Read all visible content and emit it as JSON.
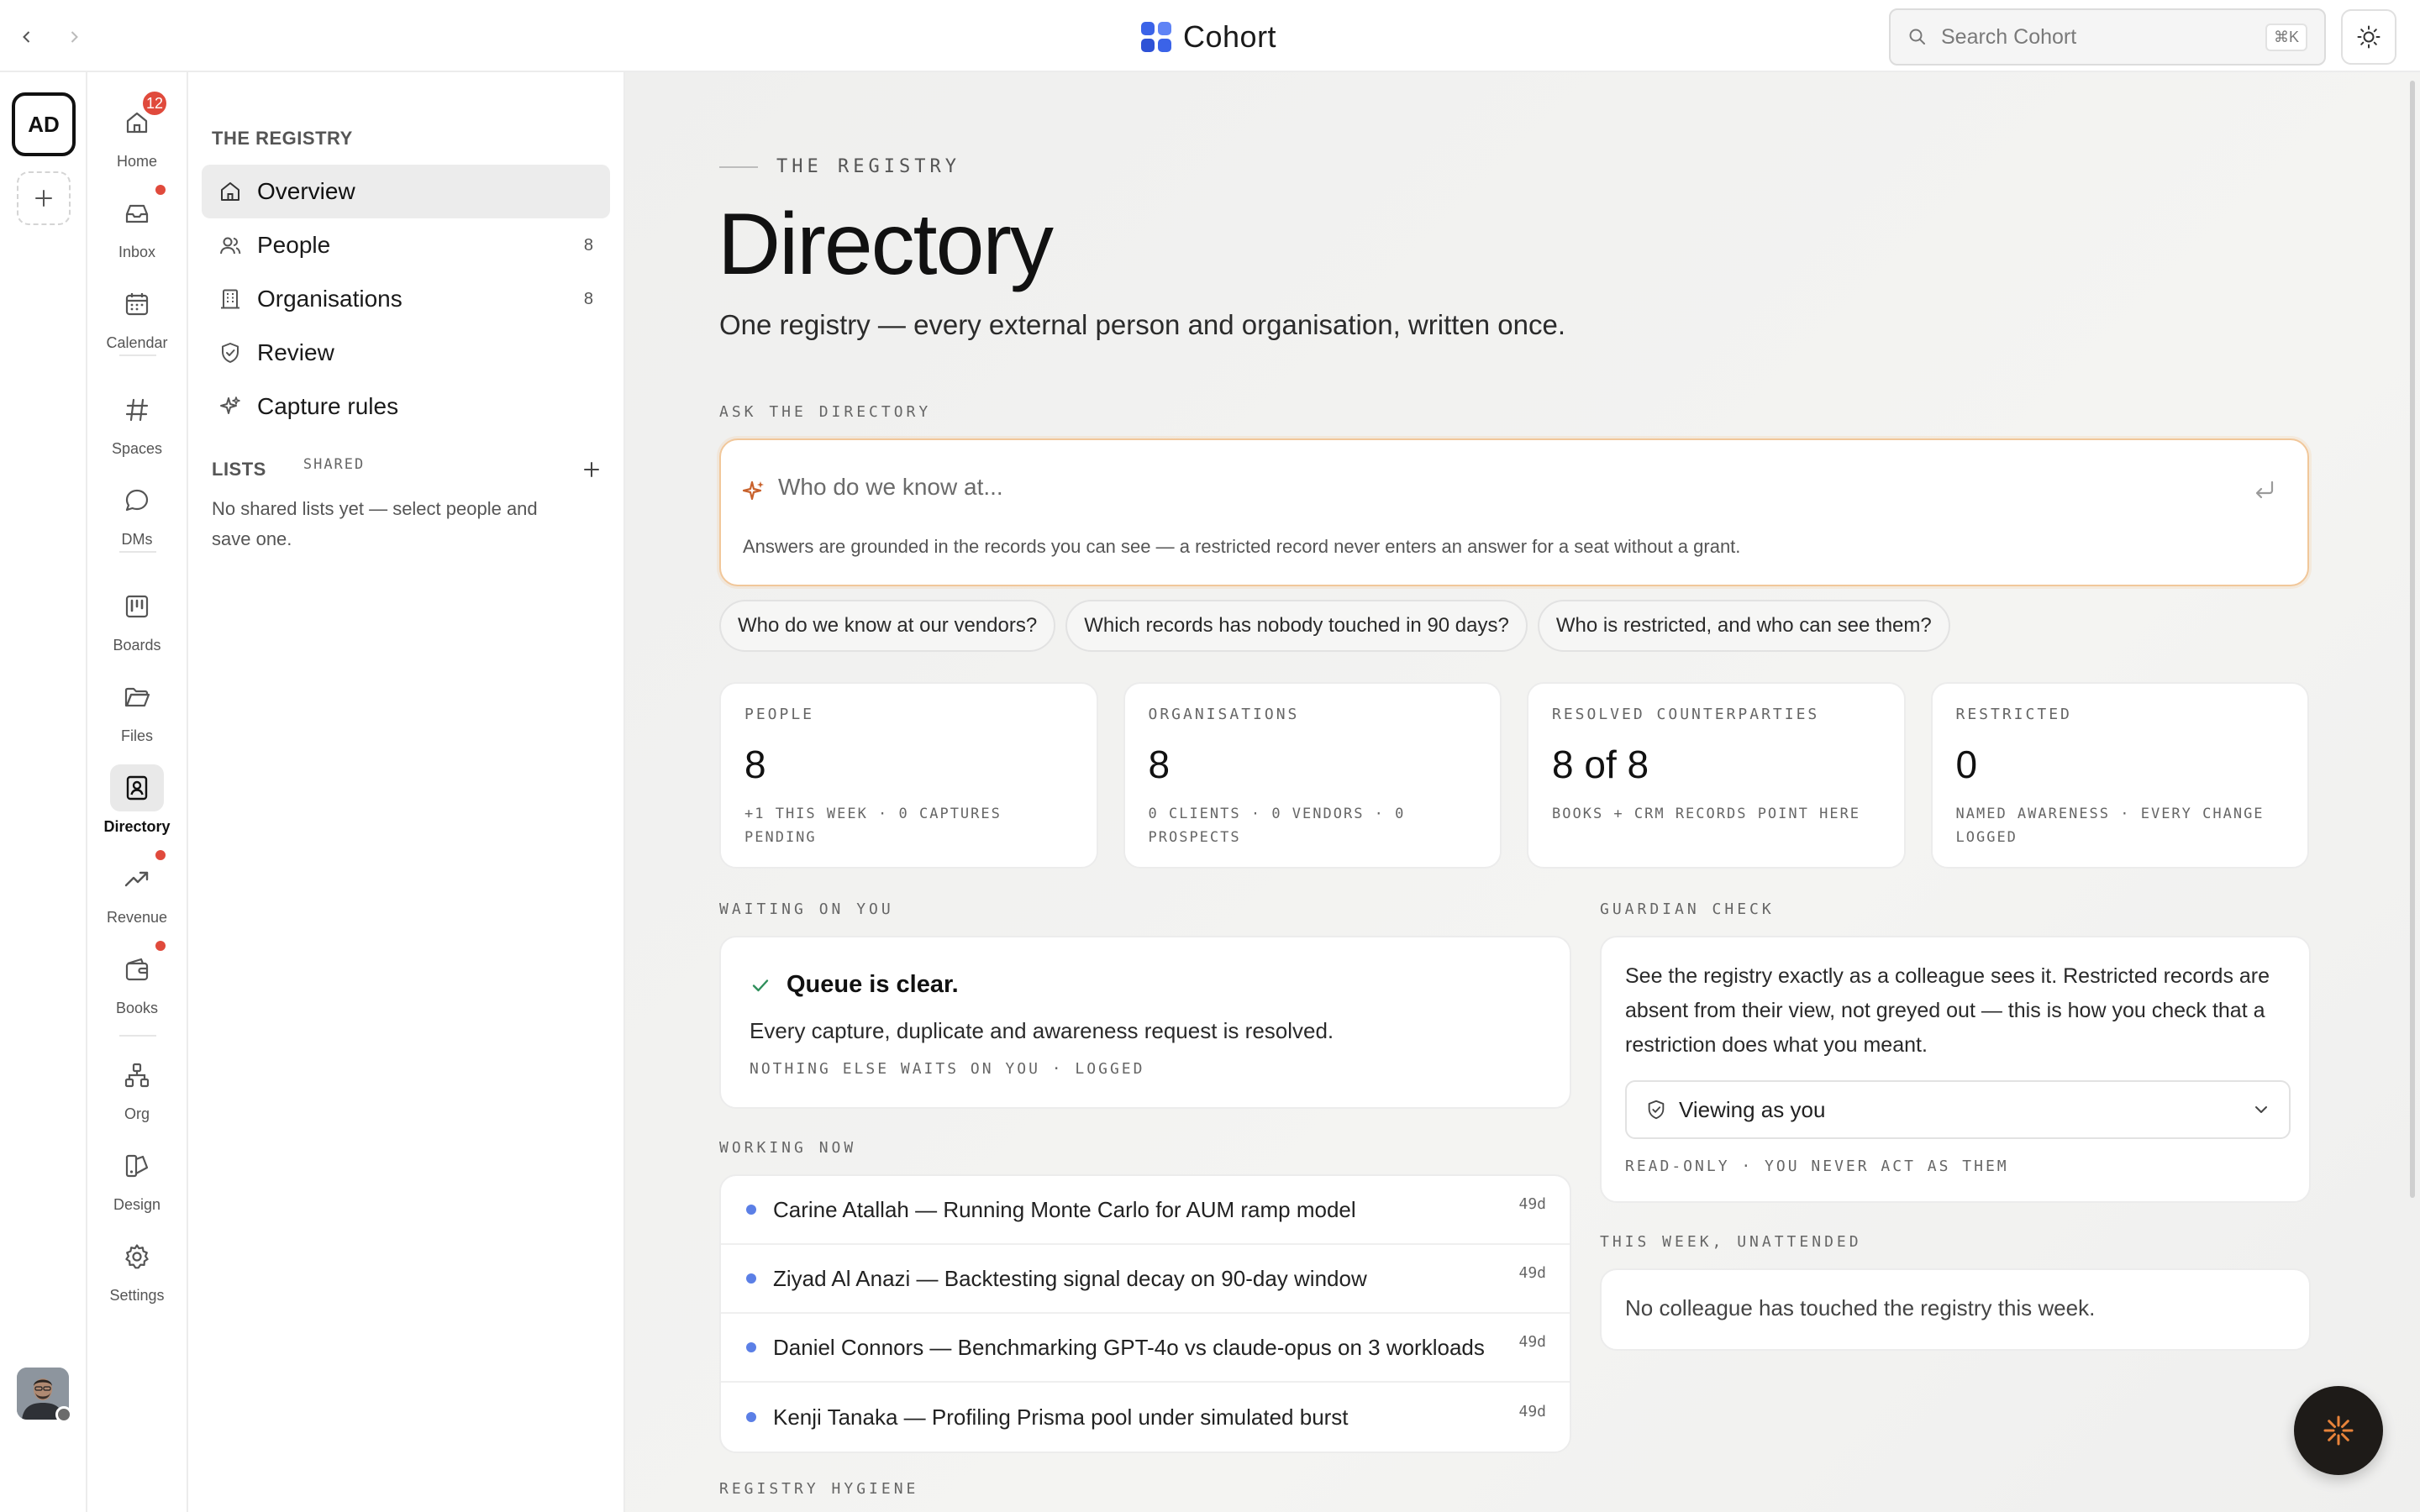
{
  "app": {
    "name": "Cohort"
  },
  "topbar": {
    "search_placeholder": "Search Cohort",
    "search_shortcut": "⌘K"
  },
  "workspace": {
    "initials": "AD"
  },
  "appnav": {
    "items": [
      {
        "label": "Home",
        "icon": "home-icon",
        "badge": "12"
      },
      {
        "label": "Inbox",
        "icon": "inbox-icon",
        "dot": true
      },
      {
        "label": "Calendar",
        "icon": "calendar-icon"
      },
      {
        "label": "Spaces",
        "icon": "hash-icon"
      },
      {
        "label": "DMs",
        "icon": "chat-bubble-icon"
      },
      {
        "label": "Boards",
        "icon": "board-icon"
      },
      {
        "label": "Files",
        "icon": "folder-icon"
      },
      {
        "label": "Directory",
        "icon": "contact-book-icon",
        "active": true
      },
      {
        "label": "Revenue",
        "icon": "trend-up-icon",
        "dot": true
      },
      {
        "label": "Books",
        "icon": "wallet-icon",
        "dot": true
      },
      {
        "label": "Org",
        "icon": "org-chart-icon"
      },
      {
        "label": "Design",
        "icon": "design-icon"
      },
      {
        "label": "Settings",
        "icon": "gear-icon"
      }
    ]
  },
  "sidebar": {
    "section": "THE REGISTRY",
    "items": [
      {
        "label": "Overview",
        "icon": "home-icon",
        "count": "",
        "active": true
      },
      {
        "label": "People",
        "icon": "people-icon",
        "count": "8"
      },
      {
        "label": "Organisations",
        "icon": "building-icon",
        "count": "8"
      },
      {
        "label": "Review",
        "icon": "shield-check-icon",
        "count": ""
      },
      {
        "label": "Capture rules",
        "icon": "sparkle-icon",
        "count": ""
      }
    ],
    "lists_label": "LISTS",
    "lists_shared": "SHARED",
    "lists_empty": "No shared lists yet — select people and save one."
  },
  "page": {
    "eyebrow": "THE REGISTRY",
    "title": "Directory",
    "subtitle": "One registry — every external person and organisation, written once."
  },
  "ask": {
    "label": "ASK THE DIRECTORY",
    "placeholder": "Who do we know at...",
    "note": "Answers are grounded in the records you can see — a restricted record never enters an answer for a seat without a grant.",
    "suggestions": [
      "Who do we know at our vendors?",
      "Which records has nobody touched in 90 days?",
      "Who is restricted, and who can see them?"
    ]
  },
  "stats": [
    {
      "label": "PEOPLE",
      "value": "8",
      "note": "+1 THIS WEEK · 0 CAPTURES PENDING"
    },
    {
      "label": "ORGANISATIONS",
      "value": "8",
      "note": "0 CLIENTS · 0 VENDORS · 0 PROSPECTS"
    },
    {
      "label": "RESOLVED COUNTERPARTIES",
      "value": "8 of 8",
      "note": "BOOKS + CRM RECORDS POINT HERE"
    },
    {
      "label": "RESTRICTED",
      "value": "0",
      "note": "NAMED AWARENESS · EVERY CHANGE LOGGED"
    }
  ],
  "waiting": {
    "label": "WAITING ON YOU",
    "title": "Queue is clear.",
    "body": "Every capture, duplicate and awareness request is resolved.",
    "meta": "NOTHING ELSE WAITS ON YOU · LOGGED"
  },
  "working": {
    "label": "WORKING NOW",
    "rows": [
      {
        "text": "Carine Atallah — Running Monte Carlo for AUM ramp model",
        "age": "49d"
      },
      {
        "text": "Ziyad Al Anazi — Backtesting signal decay on 90-day window",
        "age": "49d"
      },
      {
        "text": "Daniel Connors — Benchmarking GPT-4o vs claude-opus on 3 workloads",
        "age": "49d"
      },
      {
        "text": "Kenji Tanaka — Profiling Prisma pool under simulated burst",
        "age": "49d"
      }
    ]
  },
  "guardian": {
    "label": "GUARDIAN CHECK",
    "body": "See the registry exactly as a colleague sees it. Restricted records are absent from their view, not greyed out — this is how you check that a restriction does what you meant.",
    "select_value": "Viewing as you",
    "meta": "READ-ONLY · YOU NEVER ACT AS THEM"
  },
  "unattended": {
    "label": "THIS WEEK, UNATTENDED",
    "text": "No colleague has touched the registry this week."
  },
  "hygiene": {
    "label": "REGISTRY HYGIENE"
  },
  "colors": {
    "accent": "#3b63e8",
    "badge": "#e04a3c",
    "ask_border": "#f1c79a",
    "sparkle": "#c8612b",
    "fab": "#1e1b18"
  }
}
